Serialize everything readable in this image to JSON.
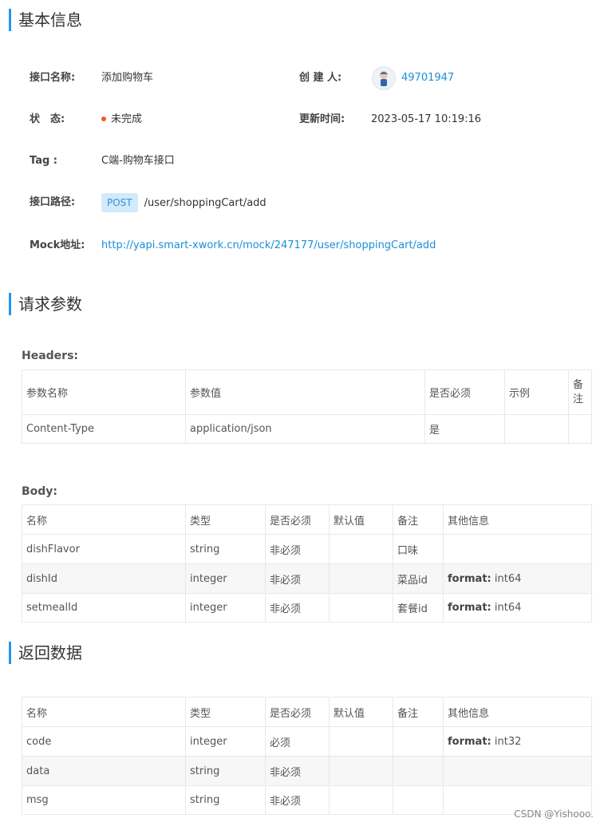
{
  "sections": {
    "basic_info": "基本信息",
    "request_params": "请求参数",
    "response_data": "返回数据"
  },
  "info": {
    "name_label": "接口名称:",
    "name_value": "添加购物车",
    "creator_label": "创 建 人:",
    "creator_value": "49701947",
    "status_label": "状　态:",
    "status_value": "未完成",
    "update_label": "更新时间:",
    "update_value": "2023-05-17 10:19:16",
    "tag_label": "Tag :",
    "tag_value": "C端-购物车接口",
    "path_label": "接口路径:",
    "method": "POST",
    "path_value": "/user/shoppingCart/add",
    "mock_label": "Mock地址:",
    "mock_value": "http://yapi.smart-xwork.cn/mock/247177/user/shoppingCart/add"
  },
  "headers": {
    "title": "Headers:",
    "columns": [
      "参数名称",
      "参数值",
      "是否必须",
      "示例",
      "备注"
    ],
    "rows": [
      [
        "Content-Type",
        "application/json",
        "是",
        "",
        ""
      ]
    ]
  },
  "body": {
    "title": "Body:",
    "columns": [
      "名称",
      "类型",
      "是否必须",
      "默认值",
      "备注",
      "其他信息"
    ],
    "rows": [
      {
        "name": "dishFlavor",
        "type": "string",
        "required": "非必须",
        "default": "",
        "note": "口味",
        "fmt_key": "",
        "fmt_val": ""
      },
      {
        "name": "dishId",
        "type": "integer",
        "required": "非必须",
        "default": "",
        "note": "菜品id",
        "fmt_key": "format:",
        "fmt_val": "int64"
      },
      {
        "name": "setmealId",
        "type": "integer",
        "required": "非必须",
        "default": "",
        "note": "套餐id",
        "fmt_key": "format:",
        "fmt_val": "int64"
      }
    ]
  },
  "response": {
    "columns": [
      "名称",
      "类型",
      "是否必须",
      "默认值",
      "备注",
      "其他信息"
    ],
    "rows": [
      {
        "name": "code",
        "type": "integer",
        "required": "必须",
        "default": "",
        "note": "",
        "fmt_key": "format:",
        "fmt_val": "int32"
      },
      {
        "name": "data",
        "type": "string",
        "required": "非必须",
        "default": "",
        "note": "",
        "fmt_key": "",
        "fmt_val": ""
      },
      {
        "name": "msg",
        "type": "string",
        "required": "非必须",
        "default": "",
        "note": "",
        "fmt_key": "",
        "fmt_val": ""
      }
    ]
  },
  "watermark": "CSDN @Yishooo.",
  "colors": {
    "accent": "#2395f1",
    "link": "#1a8fd8",
    "status_dot": "#f5562a",
    "badge_bg": "#d2eafb"
  }
}
